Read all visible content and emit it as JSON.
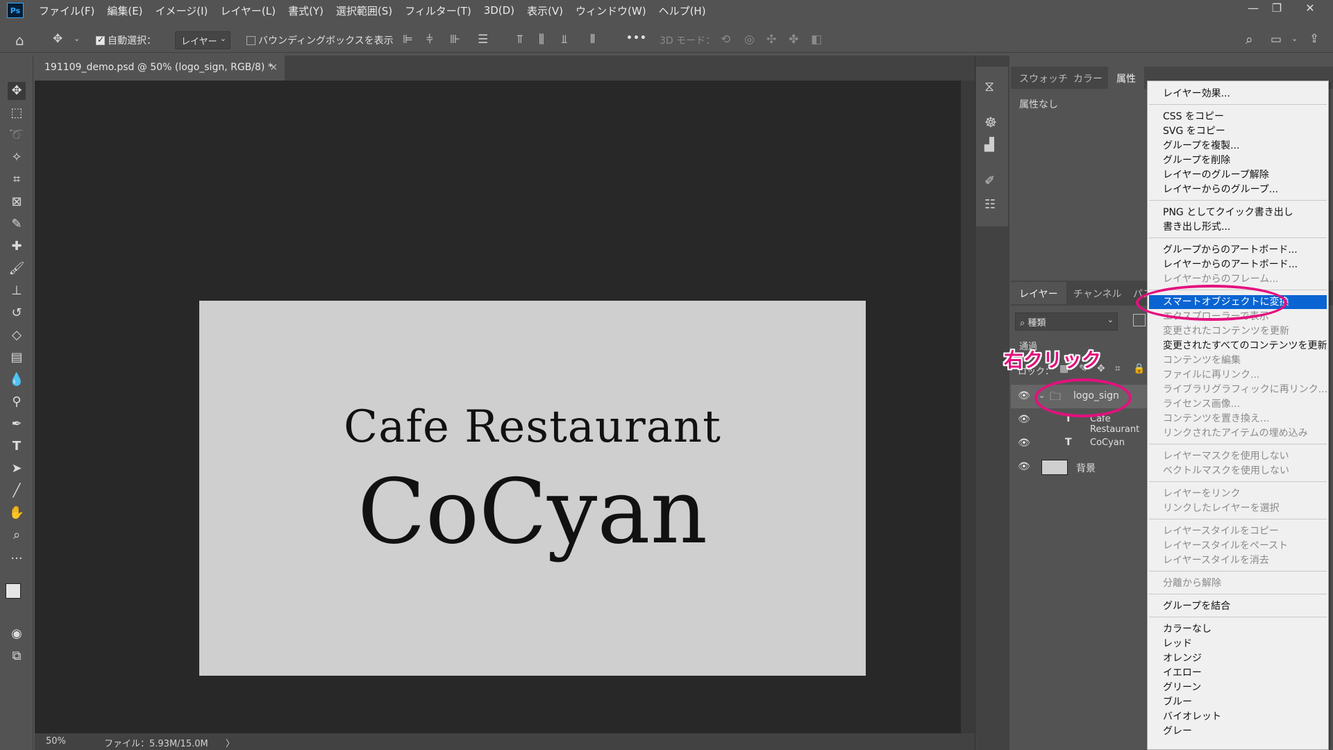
{
  "menubar": {
    "logo": "Ps",
    "items": [
      "ファイル(F)",
      "編集(E)",
      "イメージ(I)",
      "レイヤー(L)",
      "書式(Y)",
      "選択範囲(S)",
      "フィルター(T)",
      "3D(D)",
      "表示(V)",
      "ウィンドウ(W)",
      "ヘルプ(H)"
    ]
  },
  "options": {
    "auto_select_label": "自動選択：",
    "auto_select_target": "レイヤー",
    "bounding_box_label": "バウンディングボックスを表示",
    "more": "•••",
    "mode_3d_label": "3D モード："
  },
  "document": {
    "tab_title": "191109_demo.psd @ 50% (logo_sign, RGB/8) *",
    "close": "×",
    "canvas_subtitle": "Cafe Restaurant",
    "canvas_title": "CoCyan",
    "zoom": "50%",
    "file_info": "ファイル：5.93M/15.0M",
    "status_arrow": "〉"
  },
  "properties_panel": {
    "tabs": [
      "スウォッチ",
      "カラー",
      "属性"
    ],
    "active_tab": "属性",
    "empty_text": "属性なし"
  },
  "layers_panel": {
    "tabs": [
      "レイヤー",
      "チャンネル",
      "パス"
    ],
    "filter_label": "種類",
    "blend_mode": "通過",
    "lock_label": "ロック：",
    "layers": [
      {
        "name": "logo_sign",
        "type": "group"
      },
      {
        "name": "Cafe Restaurant",
        "type": "text"
      },
      {
        "name": "CoCyan",
        "type": "text"
      },
      {
        "name": "背景",
        "type": "pixel"
      }
    ]
  },
  "annotation": {
    "callout": "右クリック",
    "color": "#e4107e"
  },
  "context_menu": {
    "groups": [
      [
        {
          "label": "レイヤー効果...",
          "enabled": true
        }
      ],
      [
        {
          "label": "CSS をコピー",
          "enabled": true
        },
        {
          "label": "SVG をコピー",
          "enabled": true
        },
        {
          "label": "グループを複製...",
          "enabled": true
        },
        {
          "label": "グループを削除",
          "enabled": true
        },
        {
          "label": "レイヤーのグループ解除",
          "enabled": true
        },
        {
          "label": "レイヤーからのグループ...",
          "enabled": true
        }
      ],
      [
        {
          "label": "PNG としてクイック書き出し",
          "enabled": true
        },
        {
          "label": "書き出し形式...",
          "enabled": true
        }
      ],
      [
        {
          "label": "グループからのアートボード...",
          "enabled": true
        },
        {
          "label": "レイヤーからのアートボード...",
          "enabled": true
        },
        {
          "label": "レイヤーからのフレーム...",
          "enabled": false
        }
      ],
      [
        {
          "label": "スマートオブジェクトに変換",
          "enabled": true,
          "highlighted": true
        },
        {
          "label": "エクスプローラーで表示",
          "enabled": false
        },
        {
          "label": "変更されたコンテンツを更新",
          "enabled": false
        },
        {
          "label": "変更されたすべてのコンテンツを更新",
          "enabled": true
        },
        {
          "label": "コンテンツを編集",
          "enabled": false
        },
        {
          "label": "ファイルに再リンク...",
          "enabled": false
        },
        {
          "label": "ライブラリグラフィックに再リンク...",
          "enabled": false
        },
        {
          "label": "ライセンス画像...",
          "enabled": false
        },
        {
          "label": "コンテンツを置き換え...",
          "enabled": false
        },
        {
          "label": "リンクされたアイテムの埋め込み",
          "enabled": false
        }
      ],
      [
        {
          "label": "レイヤーマスクを使用しない",
          "enabled": false
        },
        {
          "label": "ベクトルマスクを使用しない",
          "enabled": false
        }
      ],
      [
        {
          "label": "レイヤーをリンク",
          "enabled": false
        },
        {
          "label": "リンクしたレイヤーを選択",
          "enabled": false
        }
      ],
      [
        {
          "label": "レイヤースタイルをコピー",
          "enabled": false
        },
        {
          "label": "レイヤースタイルをペースト",
          "enabled": false
        },
        {
          "label": "レイヤースタイルを消去",
          "enabled": false
        }
      ],
      [
        {
          "label": "分離から解除",
          "enabled": false
        }
      ],
      [
        {
          "label": "グループを結合",
          "enabled": true
        }
      ],
      [
        {
          "label": "カラーなし",
          "enabled": true
        },
        {
          "label": "レッド",
          "enabled": true
        },
        {
          "label": "オレンジ",
          "enabled": true
        },
        {
          "label": "イエロー",
          "enabled": true
        },
        {
          "label": "グリーン",
          "enabled": true
        },
        {
          "label": "ブルー",
          "enabled": true
        },
        {
          "label": "バイオレット",
          "enabled": true
        },
        {
          "label": "グレー",
          "enabled": true
        }
      ]
    ]
  }
}
